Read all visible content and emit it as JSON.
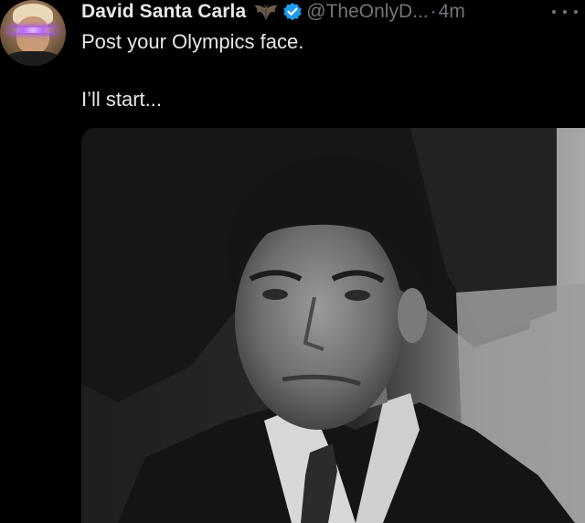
{
  "tweet": {
    "author_name": "David Santa Carla",
    "handle": "@TheOnlyD...",
    "separator": "·",
    "timestamp": "4m",
    "text_line_1": "Post your Olympics face.",
    "text_line_2": "I’ll start..."
  },
  "icons": {
    "name_emoji": "bat-icon",
    "verified": "verified-badge-icon",
    "more": "more-horizontal-icon"
  },
  "colors": {
    "background": "#000000",
    "primary_text": "#e7e9ea",
    "secondary_text": "#71767b",
    "verified_blue": "#1d9bf0"
  }
}
